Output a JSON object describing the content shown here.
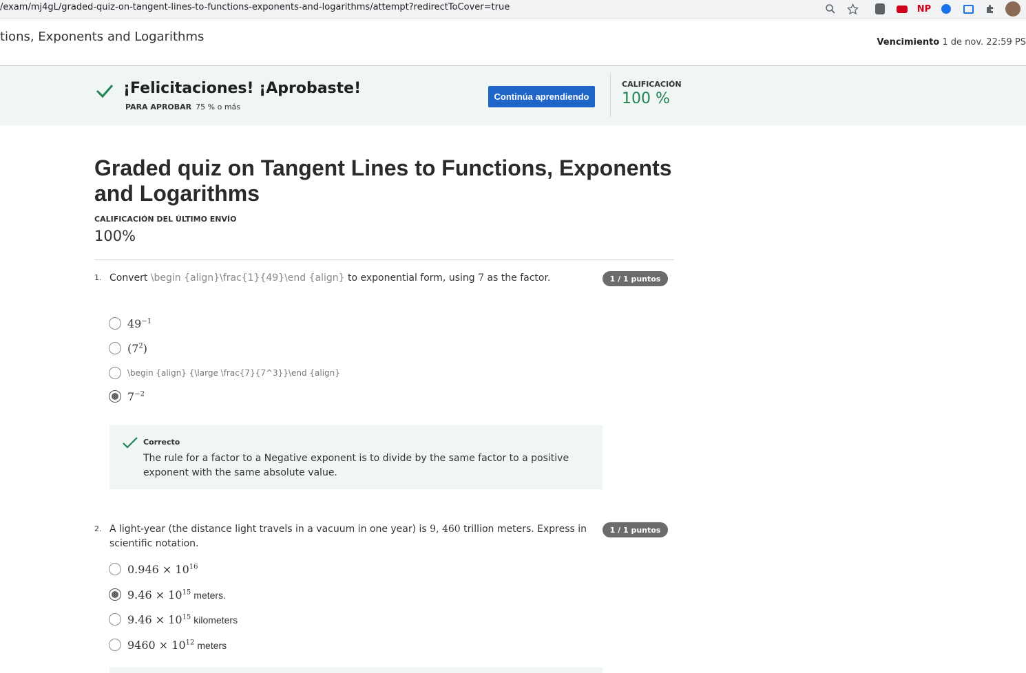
{
  "browser": {
    "url": "/exam/mj4gL/graded-quiz-on-tangent-lines-to-functions-exponents-and-logarithms/attempt?redirectToCover=true",
    "extension_np": "NP"
  },
  "header": {
    "course_title": "tions, Exponents and Logarithms",
    "due_label": "Vencimiento",
    "due_value": "1 de nov. 22:59 PS"
  },
  "banner": {
    "title": "¡Felicitaciones! ¡Aprobaste!",
    "pass_label": "PARA APROBAR",
    "pass_value": "75 % o más",
    "continue_label": "Continúa aprendiendo",
    "grade_label": "CALIFICACIÓN",
    "grade_value": "100 %",
    "accent": "#1f64c7",
    "success": "#1f8354"
  },
  "main": {
    "title": "Graded quiz on Tangent Lines to Functions, Exponents and Logarithms",
    "last_label": "CALIFICACIÓN DEL ÚLTIMO ENVÍO",
    "last_value": "100%"
  },
  "questions": [
    {
      "number": "1.",
      "text_before": "Convert ",
      "text_raw": "\\begin {align}\\frac{1}{49}\\end {align}",
      "text_mid": " to exponential form, using ",
      "text_math": "7",
      "text_after": " as the factor.",
      "points": "1 / 1 puntos",
      "options": [
        {
          "base": "49",
          "exp": "−1",
          "unit": "",
          "selected": false
        },
        {
          "base": "(7",
          "exp": "2",
          "tail": ")",
          "unit": "",
          "selected": false
        },
        {
          "raw": "\\begin {align} {\\large \\frac{7}{7^3}}\\end {align}",
          "selected": false
        },
        {
          "base": "7",
          "exp": "−2",
          "unit": "",
          "selected": true
        }
      ],
      "feedback": {
        "title": "Correcto",
        "text": "The rule for a factor to a Negative exponent is to divide by the same factor to a positive exponent with the same absolute value."
      }
    },
    {
      "number": "2.",
      "text_before": "A light-year (the distance light travels in a vacuum in one year) is ",
      "text_math": "9, 460",
      "text_after": " trillion meters. Express in scientific notation.",
      "points": "1 / 1 puntos",
      "options": [
        {
          "base": "0.946 × 10",
          "exp": "16",
          "unit": "",
          "selected": false
        },
        {
          "base": "9.46 × 10",
          "exp": "15",
          "unit": "meters.",
          "selected": true
        },
        {
          "base": "9.46 × 10",
          "exp": "15",
          "unit": "kilometers",
          "selected": false
        },
        {
          "base": "9460 × 10",
          "exp": "12",
          "unit": "meters",
          "selected": false
        }
      ]
    }
  ]
}
